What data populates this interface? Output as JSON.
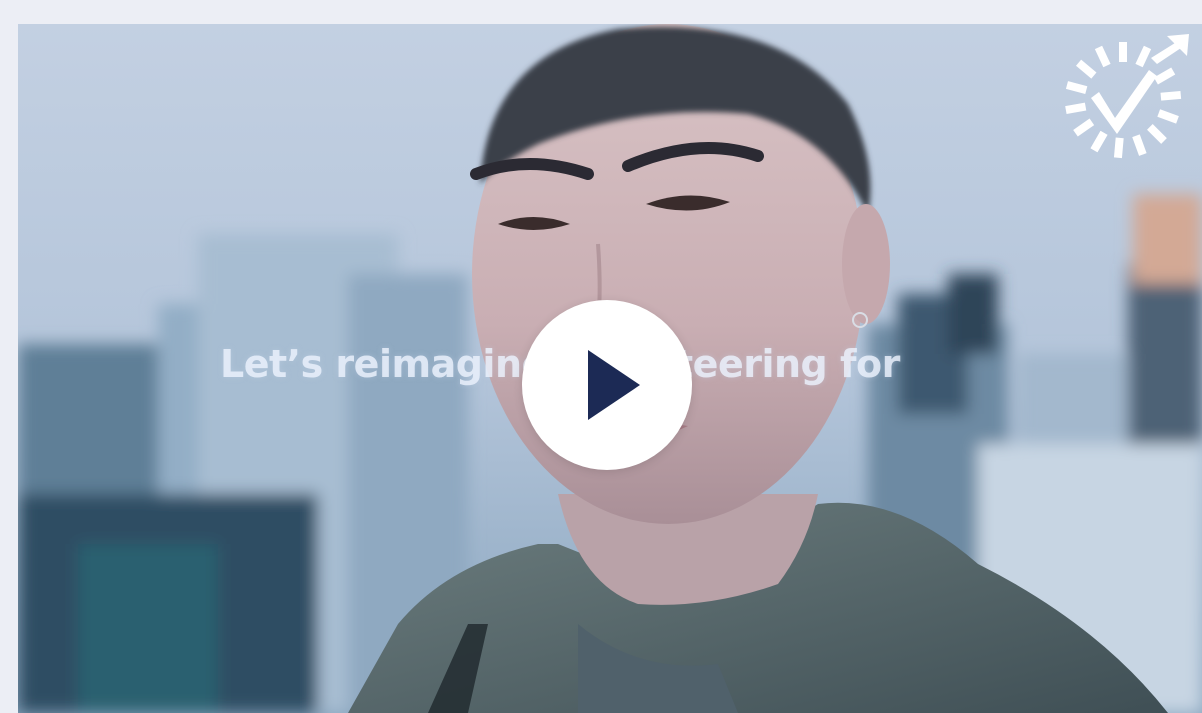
{
  "video": {
    "headline": "Let’s reimagine volunteering for",
    "play_icon": "play-icon",
    "logo_icon": "volunteer-checkmark-logo-icon"
  },
  "colors": {
    "play_button_bg": "#ffffff",
    "play_triangle": "#1c2a55",
    "headline_text": "#ecf2fc",
    "logo": "#ffffff"
  }
}
